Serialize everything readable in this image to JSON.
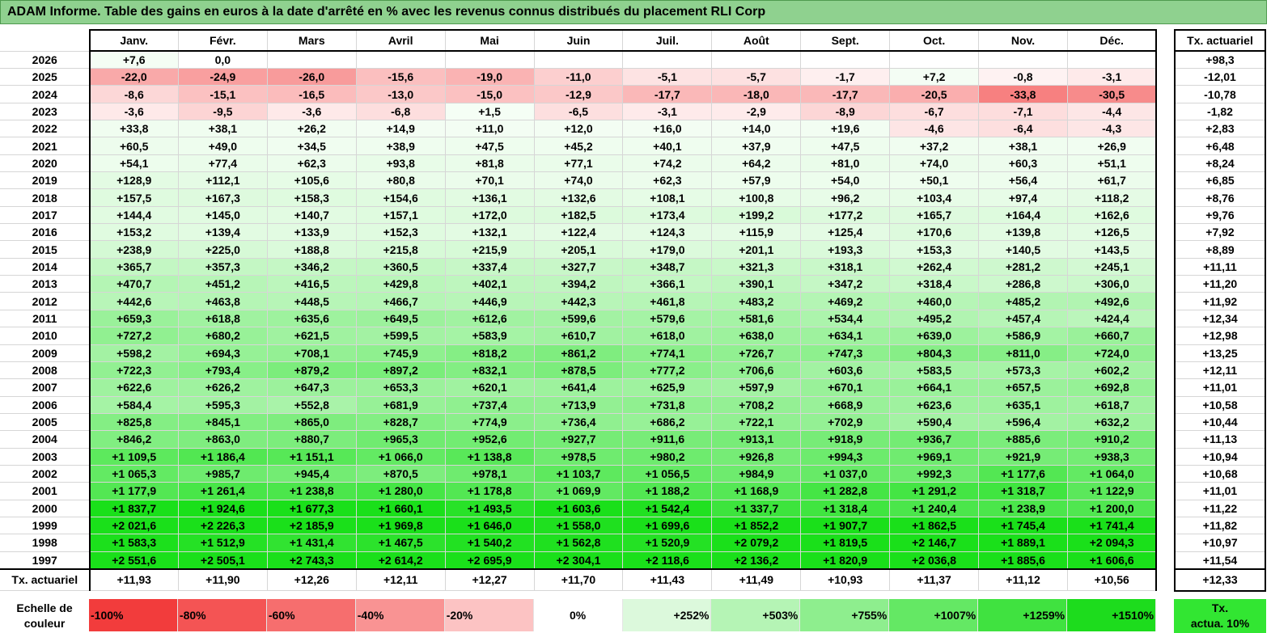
{
  "title": "ADAM Informe. Table des gains en euros à la date d'arrêté en % avec les revenus connus distribués du placement RLI Corp",
  "months": [
    "Janv.",
    "Févr.",
    "Mars",
    "Avril",
    "Mai",
    "Juin",
    "Juil.",
    "Août",
    "Sept.",
    "Oct.",
    "Nov.",
    "Déc."
  ],
  "side_header": "Tx. actuariel",
  "rows": [
    {
      "year": "2026",
      "values": [
        "+7,6",
        "0,0",
        "",
        "",
        "",
        "",
        "",
        "",
        "",
        "",
        "",
        ""
      ],
      "rate": "+98,3"
    },
    {
      "year": "2025",
      "values": [
        "-22,0",
        "-24,9",
        "-26,0",
        "-15,6",
        "-19,0",
        "-11,0",
        "-5,1",
        "-5,7",
        "-1,7",
        "+7,2",
        "-0,8",
        "-3,1"
      ],
      "rate": "-12,01"
    },
    {
      "year": "2024",
      "values": [
        "-8,6",
        "-15,1",
        "-16,5",
        "-13,0",
        "-15,0",
        "-12,9",
        "-17,7",
        "-18,0",
        "-17,7",
        "-20,5",
        "-33,8",
        "-30,5"
      ],
      "rate": "-10,78"
    },
    {
      "year": "2023",
      "values": [
        "-3,6",
        "-9,5",
        "-3,6",
        "-6,8",
        "+1,5",
        "-6,5",
        "-3,1",
        "-2,9",
        "-8,9",
        "-6,7",
        "-7,1",
        "-4,4"
      ],
      "rate": "-1,82"
    },
    {
      "year": "2022",
      "values": [
        "+33,8",
        "+38,1",
        "+26,2",
        "+14,9",
        "+11,0",
        "+12,0",
        "+16,0",
        "+14,0",
        "+19,6",
        "-4,6",
        "-6,4",
        "-4,3"
      ],
      "rate": "+2,83"
    },
    {
      "year": "2021",
      "values": [
        "+60,5",
        "+49,0",
        "+34,5",
        "+38,9",
        "+47,5",
        "+45,2",
        "+40,1",
        "+37,9",
        "+47,5",
        "+37,2",
        "+38,1",
        "+26,9"
      ],
      "rate": "+6,48"
    },
    {
      "year": "2020",
      "values": [
        "+54,1",
        "+77,4",
        "+62,3",
        "+93,8",
        "+81,8",
        "+77,1",
        "+74,2",
        "+64,2",
        "+81,0",
        "+74,0",
        "+60,3",
        "+51,1"
      ],
      "rate": "+8,24"
    },
    {
      "year": "2019",
      "values": [
        "+128,9",
        "+112,1",
        "+105,6",
        "+80,8",
        "+70,1",
        "+74,0",
        "+62,3",
        "+57,9",
        "+54,0",
        "+50,1",
        "+56,4",
        "+61,7"
      ],
      "rate": "+6,85"
    },
    {
      "year": "2018",
      "values": [
        "+157,5",
        "+167,3",
        "+158,3",
        "+154,6",
        "+136,1",
        "+132,6",
        "+108,1",
        "+100,8",
        "+96,2",
        "+103,4",
        "+97,4",
        "+118,2"
      ],
      "rate": "+8,76"
    },
    {
      "year": "2017",
      "values": [
        "+144,4",
        "+145,0",
        "+140,7",
        "+157,1",
        "+172,0",
        "+182,5",
        "+173,4",
        "+199,2",
        "+177,2",
        "+165,7",
        "+164,4",
        "+162,6"
      ],
      "rate": "+9,76"
    },
    {
      "year": "2016",
      "values": [
        "+153,2",
        "+139,4",
        "+133,9",
        "+152,3",
        "+132,1",
        "+122,4",
        "+124,3",
        "+115,9",
        "+125,4",
        "+170,6",
        "+139,8",
        "+126,5"
      ],
      "rate": "+7,92"
    },
    {
      "year": "2015",
      "values": [
        "+238,9",
        "+225,0",
        "+188,8",
        "+215,8",
        "+215,9",
        "+205,1",
        "+179,0",
        "+201,1",
        "+193,3",
        "+153,3",
        "+140,5",
        "+143,5"
      ],
      "rate": "+8,89"
    },
    {
      "year": "2014",
      "values": [
        "+365,7",
        "+357,3",
        "+346,2",
        "+360,5",
        "+337,4",
        "+327,7",
        "+348,7",
        "+321,3",
        "+318,1",
        "+262,4",
        "+281,2",
        "+245,1"
      ],
      "rate": "+11,11"
    },
    {
      "year": "2013",
      "values": [
        "+470,7",
        "+451,2",
        "+416,5",
        "+429,8",
        "+402,1",
        "+394,2",
        "+366,1",
        "+390,1",
        "+347,2",
        "+318,4",
        "+286,8",
        "+306,0"
      ],
      "rate": "+11,20"
    },
    {
      "year": "2012",
      "values": [
        "+442,6",
        "+463,8",
        "+448,5",
        "+466,7",
        "+446,9",
        "+442,3",
        "+461,8",
        "+483,2",
        "+469,2",
        "+460,0",
        "+485,2",
        "+492,6"
      ],
      "rate": "+11,92"
    },
    {
      "year": "2011",
      "values": [
        "+659,3",
        "+618,8",
        "+635,6",
        "+649,5",
        "+612,6",
        "+599,6",
        "+579,6",
        "+581,6",
        "+534,4",
        "+495,2",
        "+457,4",
        "+424,4"
      ],
      "rate": "+12,34"
    },
    {
      "year": "2010",
      "values": [
        "+727,2",
        "+680,2",
        "+621,5",
        "+599,5",
        "+583,9",
        "+610,7",
        "+618,0",
        "+638,0",
        "+634,1",
        "+639,0",
        "+586,9",
        "+660,7"
      ],
      "rate": "+12,98"
    },
    {
      "year": "2009",
      "values": [
        "+598,2",
        "+694,3",
        "+708,1",
        "+745,9",
        "+818,2",
        "+861,2",
        "+774,1",
        "+726,7",
        "+747,3",
        "+804,3",
        "+811,0",
        "+724,0"
      ],
      "rate": "+13,25"
    },
    {
      "year": "2008",
      "values": [
        "+722,3",
        "+793,4",
        "+879,2",
        "+897,2",
        "+832,1",
        "+878,5",
        "+777,2",
        "+706,6",
        "+603,6",
        "+583,5",
        "+573,3",
        "+602,2"
      ],
      "rate": "+12,11"
    },
    {
      "year": "2007",
      "values": [
        "+622,6",
        "+626,2",
        "+647,3",
        "+653,3",
        "+620,1",
        "+641,4",
        "+625,9",
        "+597,9",
        "+670,1",
        "+664,1",
        "+657,5",
        "+692,8"
      ],
      "rate": "+11,01"
    },
    {
      "year": "2006",
      "values": [
        "+584,4",
        "+595,3",
        "+552,8",
        "+681,9",
        "+737,4",
        "+713,9",
        "+731,8",
        "+708,2",
        "+668,9",
        "+623,6",
        "+635,1",
        "+618,7"
      ],
      "rate": "+10,58"
    },
    {
      "year": "2005",
      "values": [
        "+825,8",
        "+845,1",
        "+865,0",
        "+828,7",
        "+774,9",
        "+736,4",
        "+686,2",
        "+722,1",
        "+702,9",
        "+590,4",
        "+596,4",
        "+632,2"
      ],
      "rate": "+10,44"
    },
    {
      "year": "2004",
      "values": [
        "+846,2",
        "+863,0",
        "+880,7",
        "+965,3",
        "+952,6",
        "+927,7",
        "+911,6",
        "+913,1",
        "+918,9",
        "+936,7",
        "+885,6",
        "+910,2"
      ],
      "rate": "+11,13"
    },
    {
      "year": "2003",
      "values": [
        "+1 109,5",
        "+1 186,4",
        "+1 151,1",
        "+1 066,0",
        "+1 138,8",
        "+978,5",
        "+980,2",
        "+926,8",
        "+994,3",
        "+969,1",
        "+921,9",
        "+938,3"
      ],
      "rate": "+10,94"
    },
    {
      "year": "2002",
      "values": [
        "+1 065,3",
        "+985,7",
        "+945,4",
        "+870,5",
        "+978,1",
        "+1 103,7",
        "+1 056,5",
        "+984,9",
        "+1 037,0",
        "+992,3",
        "+1 177,6",
        "+1 064,0"
      ],
      "rate": "+10,68"
    },
    {
      "year": "2001",
      "values": [
        "+1 177,9",
        "+1 261,4",
        "+1 238,8",
        "+1 280,0",
        "+1 178,8",
        "+1 069,9",
        "+1 188,2",
        "+1 168,9",
        "+1 282,8",
        "+1 291,2",
        "+1 318,7",
        "+1 122,9"
      ],
      "rate": "+11,01"
    },
    {
      "year": "2000",
      "values": [
        "+1 837,7",
        "+1 924,6",
        "+1 677,3",
        "+1 660,1",
        "+1 493,5",
        "+1 603,6",
        "+1 542,4",
        "+1 337,7",
        "+1 318,4",
        "+1 240,4",
        "+1 238,9",
        "+1 200,0"
      ],
      "rate": "+11,22"
    },
    {
      "year": "1999",
      "values": [
        "+2 021,6",
        "+2 226,3",
        "+2 185,9",
        "+1 969,8",
        "+1 646,0",
        "+1 558,0",
        "+1 699,6",
        "+1 852,2",
        "+1 907,7",
        "+1 862,5",
        "+1 745,4",
        "+1 741,4"
      ],
      "rate": "+11,82"
    },
    {
      "year": "1998",
      "values": [
        "+1 583,3",
        "+1 512,9",
        "+1 431,4",
        "+1 467,5",
        "+1 540,2",
        "+1 562,8",
        "+1 520,9",
        "+2 079,2",
        "+1 819,5",
        "+2 146,7",
        "+1 889,1",
        "+2 094,3"
      ],
      "rate": "+10,97"
    },
    {
      "year": "1997",
      "values": [
        "+2 551,6",
        "+2 505,1",
        "+2 743,3",
        "+2 614,2",
        "+2 695,9",
        "+2 304,1",
        "+2 118,6",
        "+2 136,2",
        "+1 820,9",
        "+2 036,8",
        "+1 885,6",
        "+1 606,6"
      ],
      "rate": "+11,54"
    }
  ],
  "footer": {
    "label": "Tx. actuariel",
    "values": [
      "+11,93",
      "+11,90",
      "+12,26",
      "+12,11",
      "+12,27",
      "+11,70",
      "+11,43",
      "+11,49",
      "+10,93",
      "+11,37",
      "+11,12",
      "+10,56"
    ],
    "total": "+12,33"
  },
  "legend": {
    "label_line1": "Echelle de",
    "label_line2": "couleur",
    "items": [
      {
        "label": "-100%",
        "color": "#f23c3c"
      },
      {
        "label": "-80%",
        "color": "#f45454"
      },
      {
        "label": "-60%",
        "color": "#f66e6e"
      },
      {
        "label": "-40%",
        "color": "#f99393"
      },
      {
        "label": "-20%",
        "color": "#fcc3c3"
      },
      {
        "label": "0%",
        "color": "#ffffff"
      },
      {
        "label": "+252%",
        "color": "#dcf9dc"
      },
      {
        "label": "+503%",
        "color": "#b5f4b5"
      },
      {
        "label": "+755%",
        "color": "#8eee8e"
      },
      {
        "label": "+1007%",
        "color": "#64e864"
      },
      {
        "label": "+1259%",
        "color": "#40e240"
      },
      {
        "label": "+1510%",
        "color": "#1ddc1d"
      }
    ],
    "actua_line1": "Tx.",
    "actua_line2": "actua. 10%",
    "actua_color": "#32e632"
  }
}
